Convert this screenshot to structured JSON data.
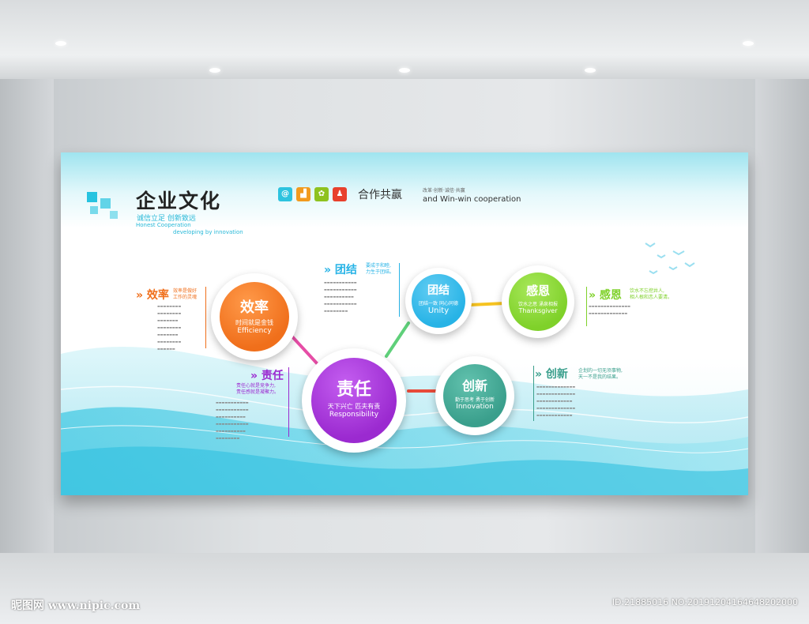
{
  "board": {
    "title": "企业文化",
    "subtitle_cn": "诚信立足  创新致远",
    "subtitle_en1": "Honest Cooperation",
    "subtitle_en2": "developing by innovation",
    "coop_cn": "合作共赢",
    "coop_tags": "改革·创新·诚信·共赢",
    "coop_en": "and Win-win  cooperation",
    "icons": [
      {
        "name": "at-icon",
        "glyph": "@",
        "color": "#2dc3df"
      },
      {
        "name": "chart-icon",
        "glyph": "▟",
        "color": "#f29a1e"
      },
      {
        "name": "flower-icon",
        "glyph": "✿",
        "color": "#8ec21f"
      },
      {
        "name": "person-icon",
        "glyph": "♟",
        "color": "#e8402c"
      }
    ]
  },
  "circles": {
    "efficiency": {
      "cn": "效率",
      "sub": "时间就是金钱",
      "en": "Efficiency",
      "color": "#f06f1b"
    },
    "responsibility": {
      "cn": "责任",
      "sub": "天下兴亡  匹夫有责",
      "en": "Responsibility",
      "color": "#9b2ad0"
    },
    "unity": {
      "cn": "团结",
      "sub": "团结一致  同心同德",
      "en": "Unity",
      "color": "#27b3e6"
    },
    "gratitude": {
      "cn": "感恩",
      "sub": "饮水之思  涌泉相报",
      "en": "Thanksgiver",
      "color": "#7fd12a"
    },
    "innovation": {
      "cn": "创新",
      "sub": "勤于思考  勇于创新",
      "en": "Innovation",
      "color": "#3a9f8c"
    }
  },
  "sections": {
    "efficiency": {
      "heading": "效率",
      "tag1": "效率是做好",
      "tag2": "工作的灵魂",
      "color": "#f06f1b"
    },
    "unity": {
      "heading": "团结",
      "tag1": "要成于和睦,",
      "tag2": "力生于团结。",
      "color": "#27b3e6"
    },
    "gratitude": {
      "heading": "感恩",
      "tag1": "饮水不忘挖井人,",
      "tag2": "相人根和恋人要清。",
      "color": "#7fd12a"
    },
    "responsibility": {
      "heading": "责任",
      "tag1": "责任心就是竞争力,",
      "tag2": "责任感就是凝聚力。",
      "color": "#9b2ad0"
    },
    "innovation": {
      "heading": "创新",
      "tag1": "企划的一切无须事物,",
      "tag2": "天一不是我的结果。",
      "color": "#3a9f8c"
    }
  },
  "watermark": {
    "left": "昵图网 www.nipic.com",
    "right": "ID:21885016 NO:20191204164648202000"
  }
}
